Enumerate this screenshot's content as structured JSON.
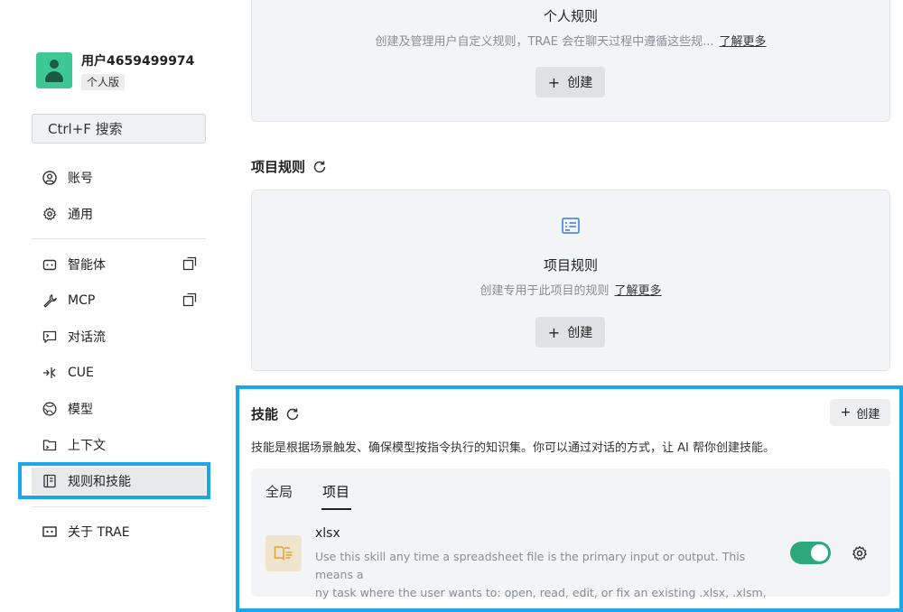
{
  "user": {
    "name": "用户4659499974",
    "plan": "个人版"
  },
  "search": {
    "label": "Ctrl+F 搜索"
  },
  "nav": {
    "account": "账号",
    "general": "通用",
    "agents": "智能体",
    "mcp": "MCP",
    "flows": "对话流",
    "cue": "CUE",
    "models": "模型",
    "context": "上下文",
    "rules_skills": "规则和技能",
    "about": "关于 TRAE"
  },
  "personal_rules": {
    "title": "个人规则",
    "desc": "创建及管理用户自定义规则，TRAE 会在聊天过程中遵循这些规...",
    "link": "了解更多",
    "create": "创建"
  },
  "project_rules": {
    "header": "项目规则",
    "title": "项目规则",
    "desc": "创建专用于此项目的规则",
    "link": "了解更多",
    "create": "创建"
  },
  "skills": {
    "header": "技能",
    "create": "创建",
    "desc": "技能是根据场景触发、确保模型按指令执行的知识集。你可以通过对话的方式，让 AI 帮你创建技能。",
    "tabs": [
      "全局",
      "项目"
    ],
    "active_tab": "项目",
    "items": [
      {
        "name": "xlsx",
        "desc_line1": "Use this skill any time a spreadsheet file is the primary input or output. This means a",
        "desc_line2": "ny task where the user wants to: open, read, edit, or fix an existing .xlsx, .xlsm, .csv, ...",
        "enabled": true
      }
    ]
  },
  "colors": {
    "accent_green": "#2ea87a",
    "highlight_blue": "#1aa7ec",
    "avatar_bg": "#3dc896",
    "project_icon_blue": "#3b7ddd"
  }
}
